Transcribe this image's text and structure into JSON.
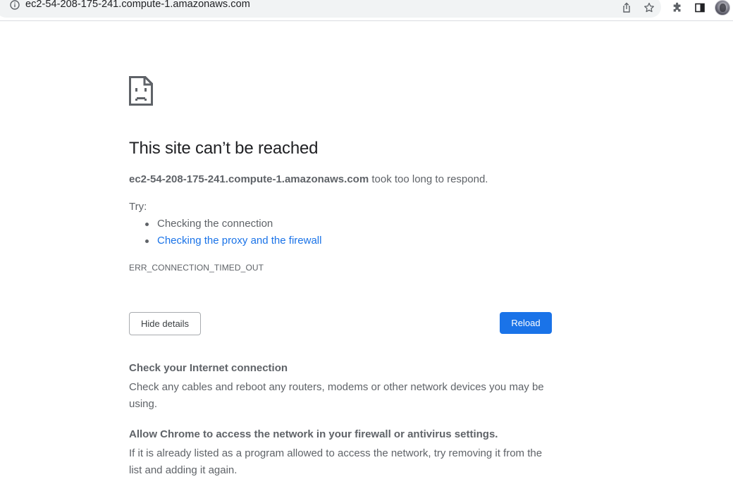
{
  "browser": {
    "url": "ec2-54-208-175-241.compute-1.amazonaws.com",
    "icons": [
      "info-icon",
      "share-icon",
      "bookmark-star-icon",
      "extensions-puzzle-icon",
      "side-panel-icon",
      "profile-avatar"
    ]
  },
  "error_page": {
    "title": "This site can’t be reached",
    "host": "ec2-54-208-175-241.compute-1.amazonaws.com",
    "summary_suffix": " took too long to respond.",
    "try_label": "Try:",
    "suggestions": [
      {
        "text": "Checking the connection",
        "is_link": false
      },
      {
        "text": "Checking the proxy and the firewall",
        "is_link": true
      }
    ],
    "error_code": "ERR_CONNECTION_TIMED_OUT",
    "buttons": {
      "details": "Hide details",
      "reload": "Reload"
    },
    "details": [
      {
        "heading": "Check your Internet connection",
        "body": "Check any cables and reboot any routers, modems or other network devices you may be using."
      },
      {
        "heading": "Allow Chrome to access the network in your firewall or antivirus settings.",
        "body": "If it is already listed as a program allowed to access the network, try removing it from the list and adding it again."
      }
    ]
  },
  "colors": {
    "accent": "#1a73e8",
    "text_primary": "#202124",
    "text_secondary": "#5f6368",
    "omnibox_bg": "#f1f3f4"
  }
}
